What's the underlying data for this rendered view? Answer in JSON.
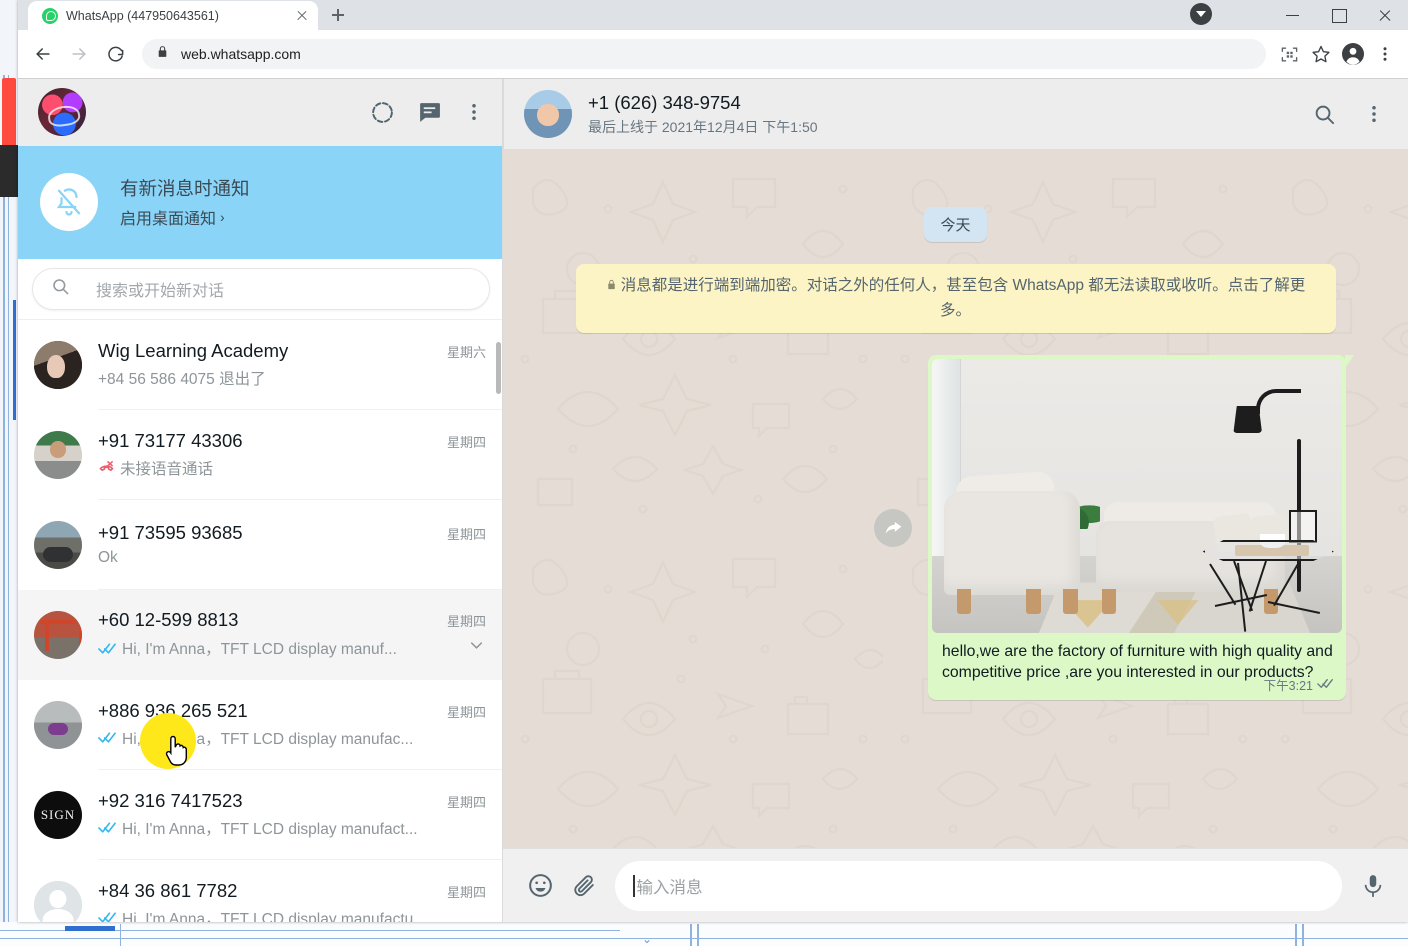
{
  "browser": {
    "tab": {
      "title": "WhatsApp  (447950643561)",
      "favicon": "whatsapp-icon"
    },
    "new_tab_label": "+",
    "omnibox": {
      "url": "web.whatsapp.com",
      "lock_icon": "lock-icon"
    },
    "toolbar_icons": [
      "back-icon",
      "forward-icon",
      "reload-icon",
      "qr-code-icon",
      "bookmark-star-icon",
      "profile-icon",
      "chrome-menu-icon"
    ],
    "download_indicator": "download-icon",
    "window_controls": [
      "minimize",
      "maximize",
      "close"
    ]
  },
  "sidebar": {
    "header": {
      "avatar": "user-avatar",
      "icons": [
        "status-icon",
        "new-chat-icon",
        "menu-icon"
      ]
    },
    "notification_banner": {
      "icon": "bell-off-icon",
      "title": "有新消息时通知",
      "subtitle": "启用桌面通知",
      "chevron": "›"
    },
    "search": {
      "icon": "search-icon",
      "placeholder": "搜索或开始新对话",
      "value": ""
    },
    "chats": [
      {
        "avatar": "wig-mannequin-avatar",
        "name": "Wig Learning Academy",
        "time": "星期六",
        "preview": "+84 56 586 4075 退出了",
        "ticks": "",
        "selected": false
      },
      {
        "avatar": "man-selfie-avatar",
        "name": "+91 73177 43306",
        "time": "星期四",
        "preview": "未接语音通话",
        "ticks": "",
        "missed_call": true,
        "selected": false
      },
      {
        "avatar": "motorbike-avatar",
        "name": "+91 73595 93685",
        "time": "星期四",
        "preview": "Ok",
        "ticks": "",
        "selected": false
      },
      {
        "avatar": "torii-gate-avatar",
        "name": "+60 12-599 8813",
        "time": "星期四",
        "preview": "Hi, I'm Anna，TFT LCD display manuf...",
        "ticks": "read",
        "chevron": true,
        "selected": true
      },
      {
        "avatar": "masked-man-avatar",
        "name": "+886 936 265 521",
        "time": "星期四",
        "preview": "Hi, I'm Anna，TFT LCD display manufac...",
        "ticks": "read",
        "selected": false
      },
      {
        "avatar": "sign-display-logo-avatar",
        "name": "+92 316 7417523",
        "time": "星期四",
        "preview": "Hi, I'm Anna，TFT LCD display manufact...",
        "ticks": "read",
        "avatar_text": "SIGN",
        "selected": false
      },
      {
        "avatar": "default-person-avatar",
        "name": "+84 36 861 7782",
        "time": "星期四",
        "preview": "Hi, I'm Anna，TFT LCD display manufactu...",
        "ticks": "read",
        "selected": false
      }
    ]
  },
  "chat": {
    "header": {
      "avatar": "baby-photo-avatar",
      "title": "+1 (626) 348-9754",
      "subtitle": "最后上线于 2021年12月4日 下午1:50",
      "icons": [
        "search-icon",
        "menu-icon"
      ]
    },
    "date_divider": "今天",
    "encryption_notice": {
      "lock_icon": "lock-icon",
      "text": "消息都是进行端到端加密。对话之外的任何人，甚至包含 WhatsApp 都无法读取或收听。点击了解更多。"
    },
    "messages": [
      {
        "direction": "outgoing",
        "image": "living-room-furniture-photo",
        "text": "hello,we are the factory of furniture with high quality and competitive price ,are you interested in our products?",
        "time": "下午3:21",
        "ticks": "read",
        "forward_button": "forward-icon"
      }
    ],
    "composer": {
      "emoji_icon": "emoji-icon",
      "attach_icon": "paperclip-icon",
      "placeholder": "输入消息",
      "value": "",
      "mic_icon": "microphone-icon"
    }
  },
  "colors": {
    "whatsapp_green": "#25d366",
    "outgoing_bubble": "#dcf8c6",
    "chat_bg": "#e5ddd5",
    "banner_blue": "#8ad4f8",
    "encryption_yellow": "#fdf4c5",
    "date_chip_blue": "#d3e5f2",
    "tick_blue": "#34b7f1",
    "highlight_yellow": "#ffe81a",
    "missed_call_red": "#f15c6d"
  }
}
